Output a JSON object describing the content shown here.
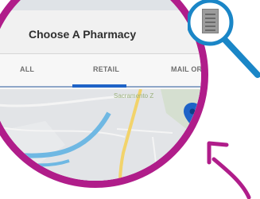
{
  "app_bar": {
    "title": "Choose A Pharmacy"
  },
  "tabs": [
    {
      "label": "ALL",
      "selected": false
    },
    {
      "label": "RETAIL",
      "selected": true
    },
    {
      "label": "MAIL ORDER",
      "selected": false
    }
  ],
  "map": {
    "place_label": "Sacramento Z"
  },
  "colors": {
    "accent": "#1e63c7",
    "callout_magenta": "#b01d8a",
    "magnifier_blue": "#1a86c7"
  },
  "icons": {
    "menu": "hamburger-menu-icon",
    "zoom": "magnifying-glass-icon",
    "map_pin": "map-pin-icon",
    "location": "locate-icon"
  }
}
